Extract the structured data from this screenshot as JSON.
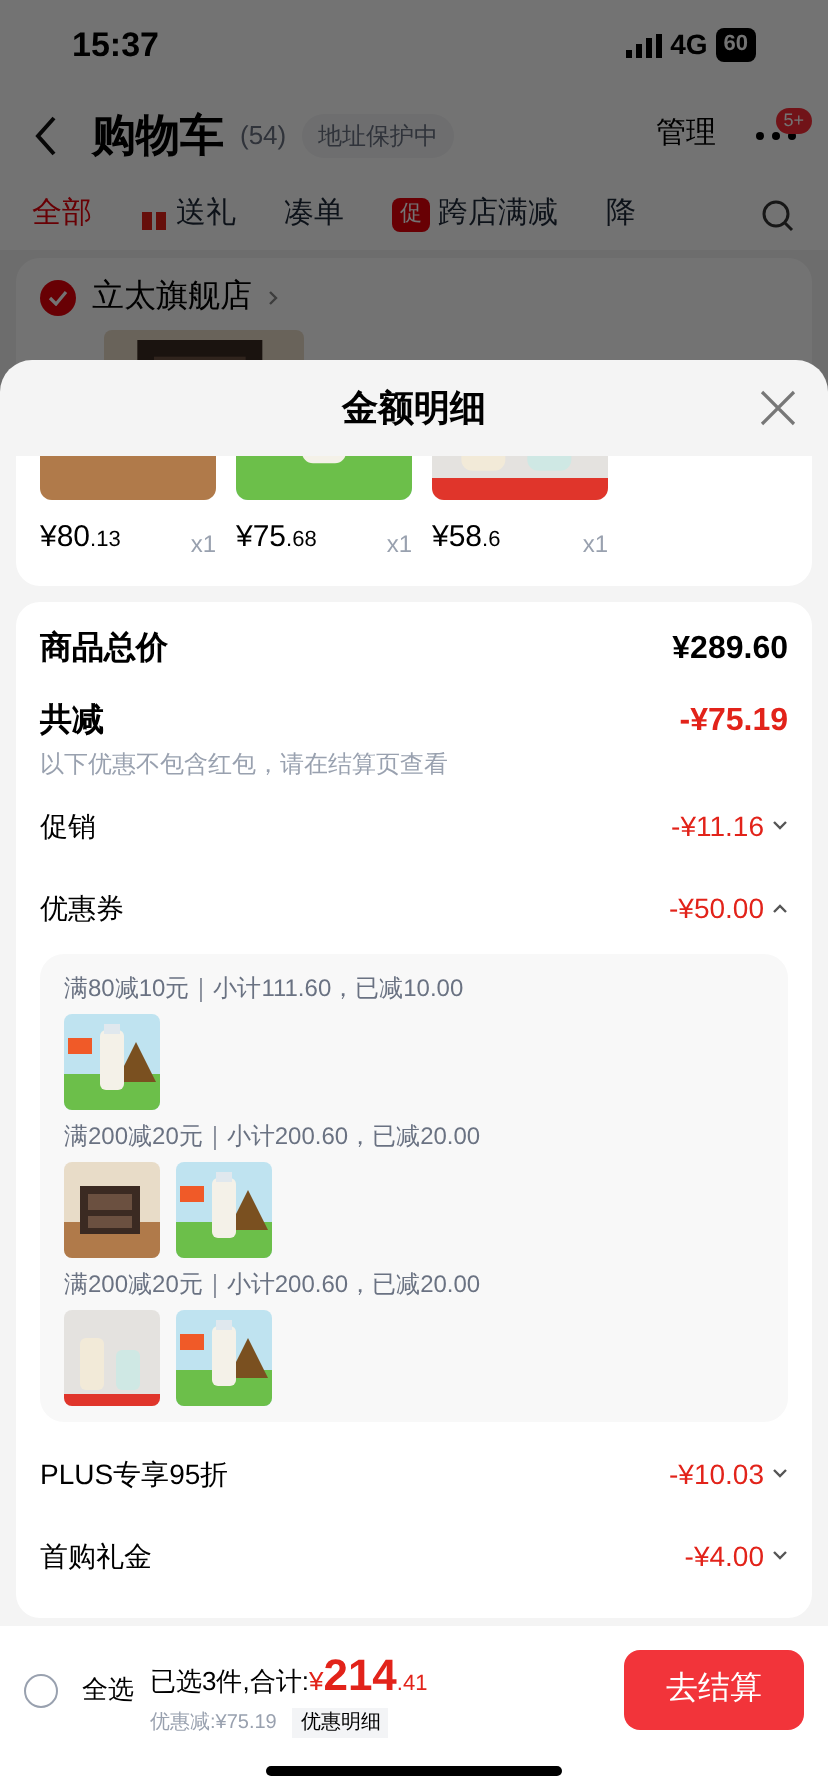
{
  "status_bar": {
    "time": "15:37",
    "network": "4G",
    "battery": "60"
  },
  "header": {
    "title": "购物车",
    "count": "(54)",
    "address": "地址保护中",
    "manage": "管理",
    "badge": "5+"
  },
  "tabs": [
    {
      "label": "全部",
      "kind": "plain",
      "selected": true
    },
    {
      "label": "送礼",
      "kind": "gift",
      "selected": false
    },
    {
      "label": "凑单",
      "kind": "plain",
      "selected": false
    },
    {
      "label": "跨店满减",
      "kind": "promo",
      "badge": "促",
      "selected": false
    },
    {
      "label": "降",
      "kind": "plain",
      "selected": false
    }
  ],
  "store": {
    "name": "立太旗舰店",
    "checked": true
  },
  "sheet": {
    "title": "金额明细",
    "products": [
      {
        "price": "¥80",
        "decimals": ".13",
        "qty": "x1"
      },
      {
        "price": "¥75",
        "decimals": ".68",
        "qty": "x1"
      },
      {
        "price": "¥58",
        "decimals": ".6",
        "qty": "x1"
      }
    ],
    "total": {
      "label": "商品总价",
      "value": "¥289.60"
    },
    "discount": {
      "label": "共减",
      "value": "-¥75.19",
      "note": "以下优惠不包含红包，请在结算页查看"
    },
    "items": [
      {
        "label": "促销",
        "value": "-¥11.16",
        "expanded": false
      },
      {
        "label": "优惠券",
        "value": "-¥50.00",
        "expanded": true,
        "groups": [
          {
            "text": "满80减10元｜小计111.60，已减10.00"
          },
          {
            "text": "满200减20元｜小计200.60，已减20.00"
          },
          {
            "text": "满200减20元｜小计200.60，已减20.00"
          }
        ]
      },
      {
        "label": "PLUS专享95折",
        "value": "-¥10.03",
        "expanded": false
      },
      {
        "label": "首购礼金",
        "value": "-¥4.00",
        "expanded": false
      }
    ]
  },
  "footer": {
    "select_all": {
      "label": "全选",
      "checked": false
    },
    "selected": "已选3件,合计:",
    "currency": "¥",
    "amount": "214",
    "decimals": ".41",
    "saved": "优惠减:¥75.19",
    "detail": "优惠明细",
    "checkout": "去结算"
  }
}
